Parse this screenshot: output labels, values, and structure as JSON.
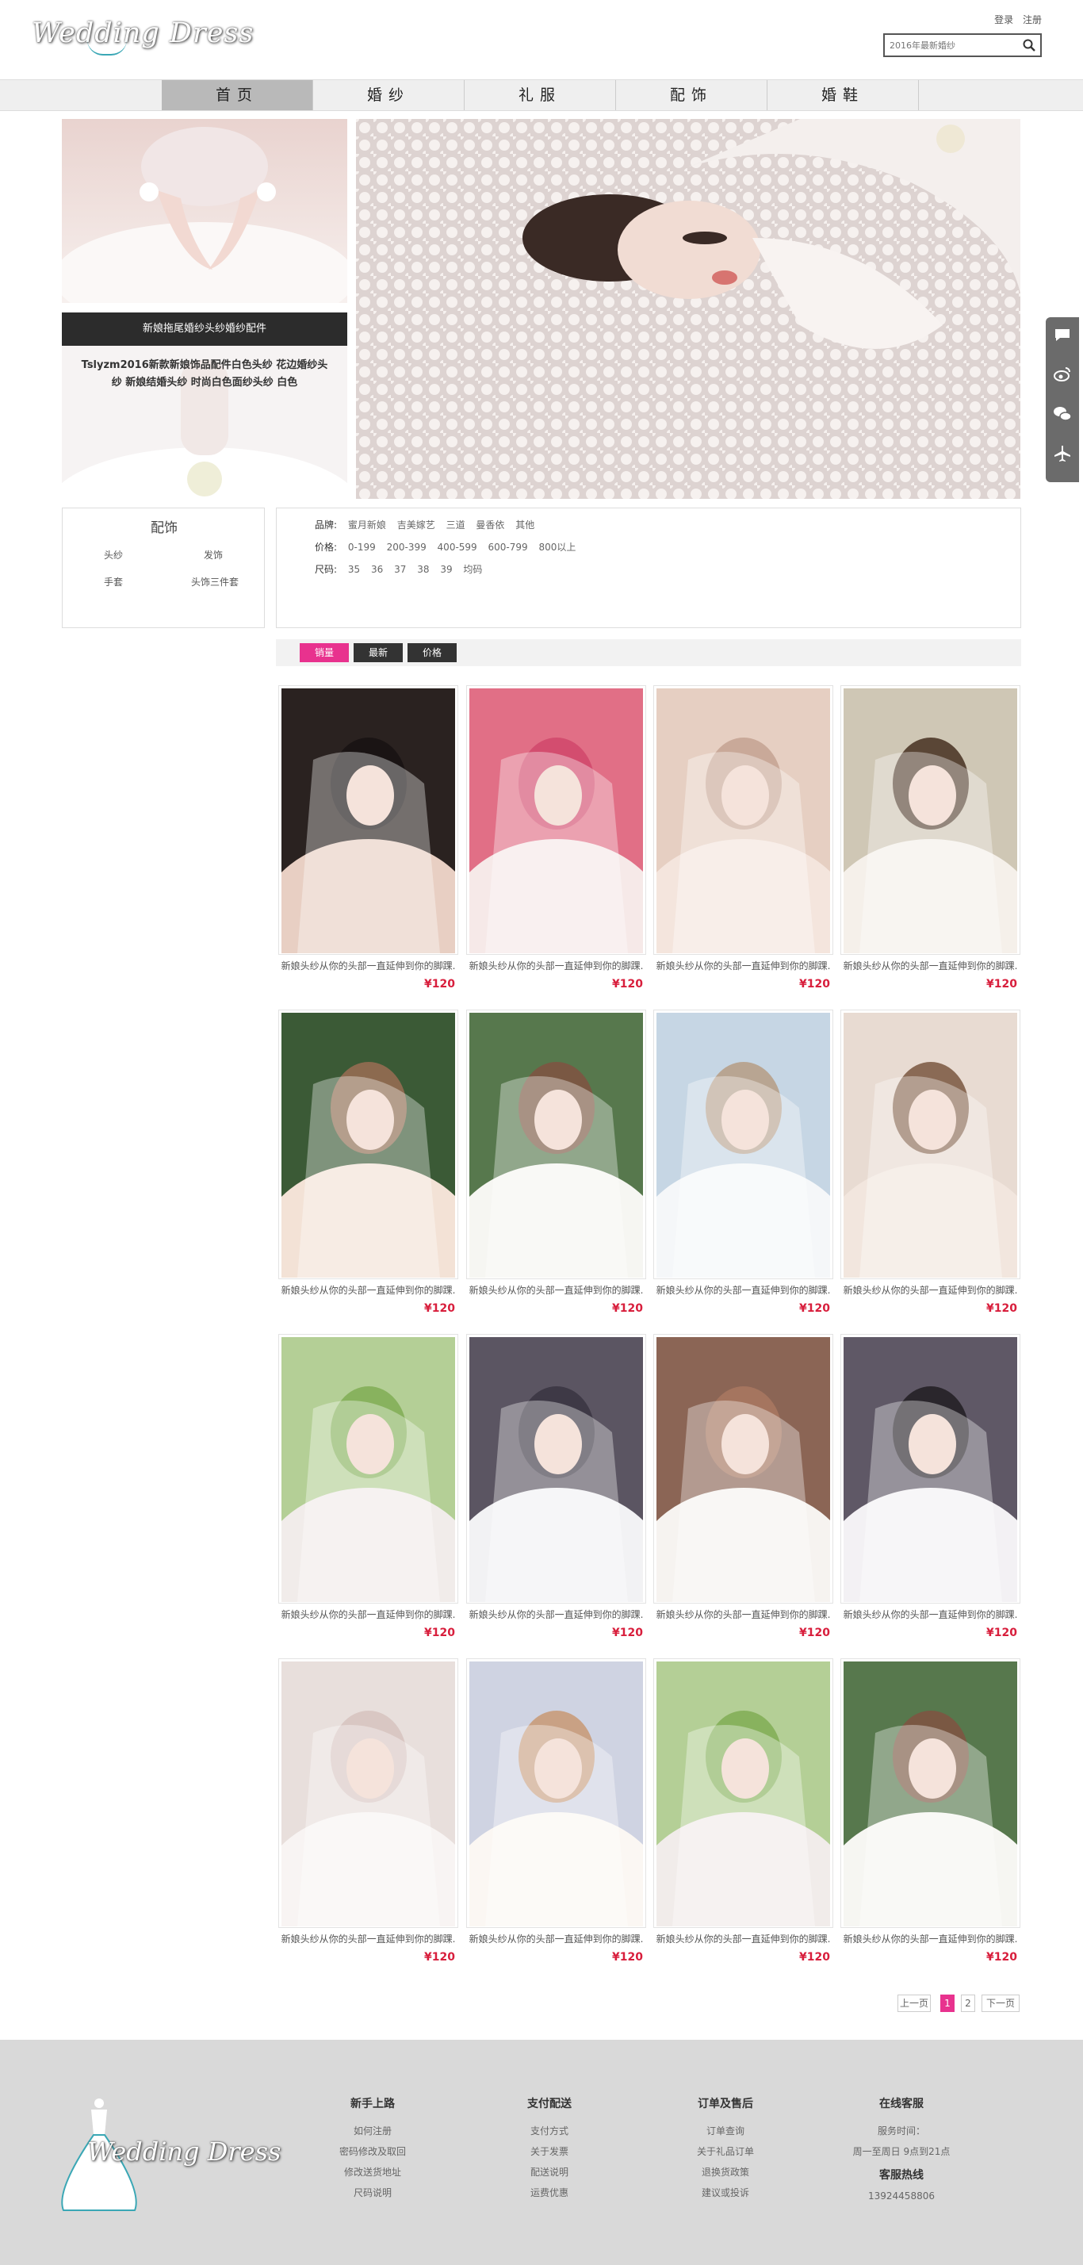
{
  "header": {
    "logo": "Wedding Dress",
    "login": "登录",
    "register": "注册",
    "search_placeholder": "2016年最新婚纱"
  },
  "nav": [
    "首页",
    "婚纱",
    "礼服",
    "配饰",
    "婚鞋"
  ],
  "banner": {
    "dark_bar": "新娘拖尾婚纱头纱婚纱配件",
    "promo_line1": "Tslyzm2016新款新娘饰品配件白色头纱 花边婚纱头",
    "promo_line2": "纱 新娘结婚头纱 时尚白色面纱头纱 白色"
  },
  "category": {
    "title": "配饰",
    "items": [
      "头纱",
      "发饰",
      "手套",
      "头饰三件套"
    ]
  },
  "filters": {
    "brand_label": "品牌:",
    "brands": [
      "蜜月新娘",
      "吉美嫁艺",
      "三道",
      "曼香依",
      "其他"
    ],
    "price_label": "价格:",
    "prices": [
      "0-199",
      "200-399",
      "400-599",
      "600-799",
      "800以上"
    ],
    "size_label": "尺码:",
    "sizes": [
      "35",
      "36",
      "37",
      "38",
      "39",
      "均码"
    ]
  },
  "sort": [
    "销量",
    "最新",
    "价格"
  ],
  "products": [
    {
      "desc": "新娘头纱从你的头部一直延伸到你的脚踝.",
      "price": "¥120"
    },
    {
      "desc": "新娘头纱从你的头部一直延伸到你的脚踝.",
      "price": "¥120"
    },
    {
      "desc": "新娘头纱从你的头部一直延伸到你的脚踝.",
      "price": "¥120"
    },
    {
      "desc": "新娘头纱从你的头部一直延伸到你的脚踝.",
      "price": "¥120"
    },
    {
      "desc": "新娘头纱从你的头部一直延伸到你的脚踝.",
      "price": "¥120"
    },
    {
      "desc": "新娘头纱从你的头部一直延伸到你的脚踝.",
      "price": "¥120"
    },
    {
      "desc": "新娘头纱从你的头部一直延伸到你的脚踝.",
      "price": "¥120"
    },
    {
      "desc": "新娘头纱从你的头部一直延伸到你的脚踝.",
      "price": "¥120"
    },
    {
      "desc": "新娘头纱从你的头部一直延伸到你的脚踝.",
      "price": "¥120"
    },
    {
      "desc": "新娘头纱从你的头部一直延伸到你的脚踝.",
      "price": "¥120"
    },
    {
      "desc": "新娘头纱从你的头部一直延伸到你的脚踝.",
      "price": "¥120"
    },
    {
      "desc": "新娘头纱从你的头部一直延伸到你的脚踝.",
      "price": "¥120"
    },
    {
      "desc": "新娘头纱从你的头部一直延伸到你的脚踝.",
      "price": "¥120"
    },
    {
      "desc": "新娘头纱从你的头部一直延伸到你的脚踝.",
      "price": "¥120"
    },
    {
      "desc": "新娘头纱从你的头部一直延伸到你的脚踝.",
      "price": "¥120"
    },
    {
      "desc": "新娘头纱从你的头部一直延伸到你的脚踝.",
      "price": "¥120"
    }
  ],
  "pagination": {
    "prev": "上一页",
    "pages": [
      "1",
      "2"
    ],
    "next": "下一页"
  },
  "footer": {
    "logo": "Wedding Dress",
    "columns": [
      {
        "title": "新手上路",
        "links": [
          "如何注册",
          "密码修改及取回",
          "修改送货地址",
          "尺码说明"
        ]
      },
      {
        "title": "支付配送",
        "links": [
          "支付方式",
          "关于发票",
          "配送说明",
          "运费优惠"
        ]
      },
      {
        "title": "订单及售后",
        "links": [
          "订单查询",
          "关于礼品订单",
          "退换货政策",
          "建议或投诉"
        ]
      },
      {
        "title": "在线客服",
        "links": [
          "服务时间：",
          "周一至周日 9点到21点"
        ],
        "hotline_title": "客服热线",
        "hotline": "13924458806"
      }
    ]
  },
  "colors": {
    "accent": "#e8328e",
    "price": "#d81e3c",
    "footer_bg": "#d9d9d9",
    "nav_bg": "#efefef"
  },
  "icons": [
    "search-icon",
    "chat-icon",
    "weibo-icon",
    "wechat-icon",
    "airplane-icon"
  ]
}
